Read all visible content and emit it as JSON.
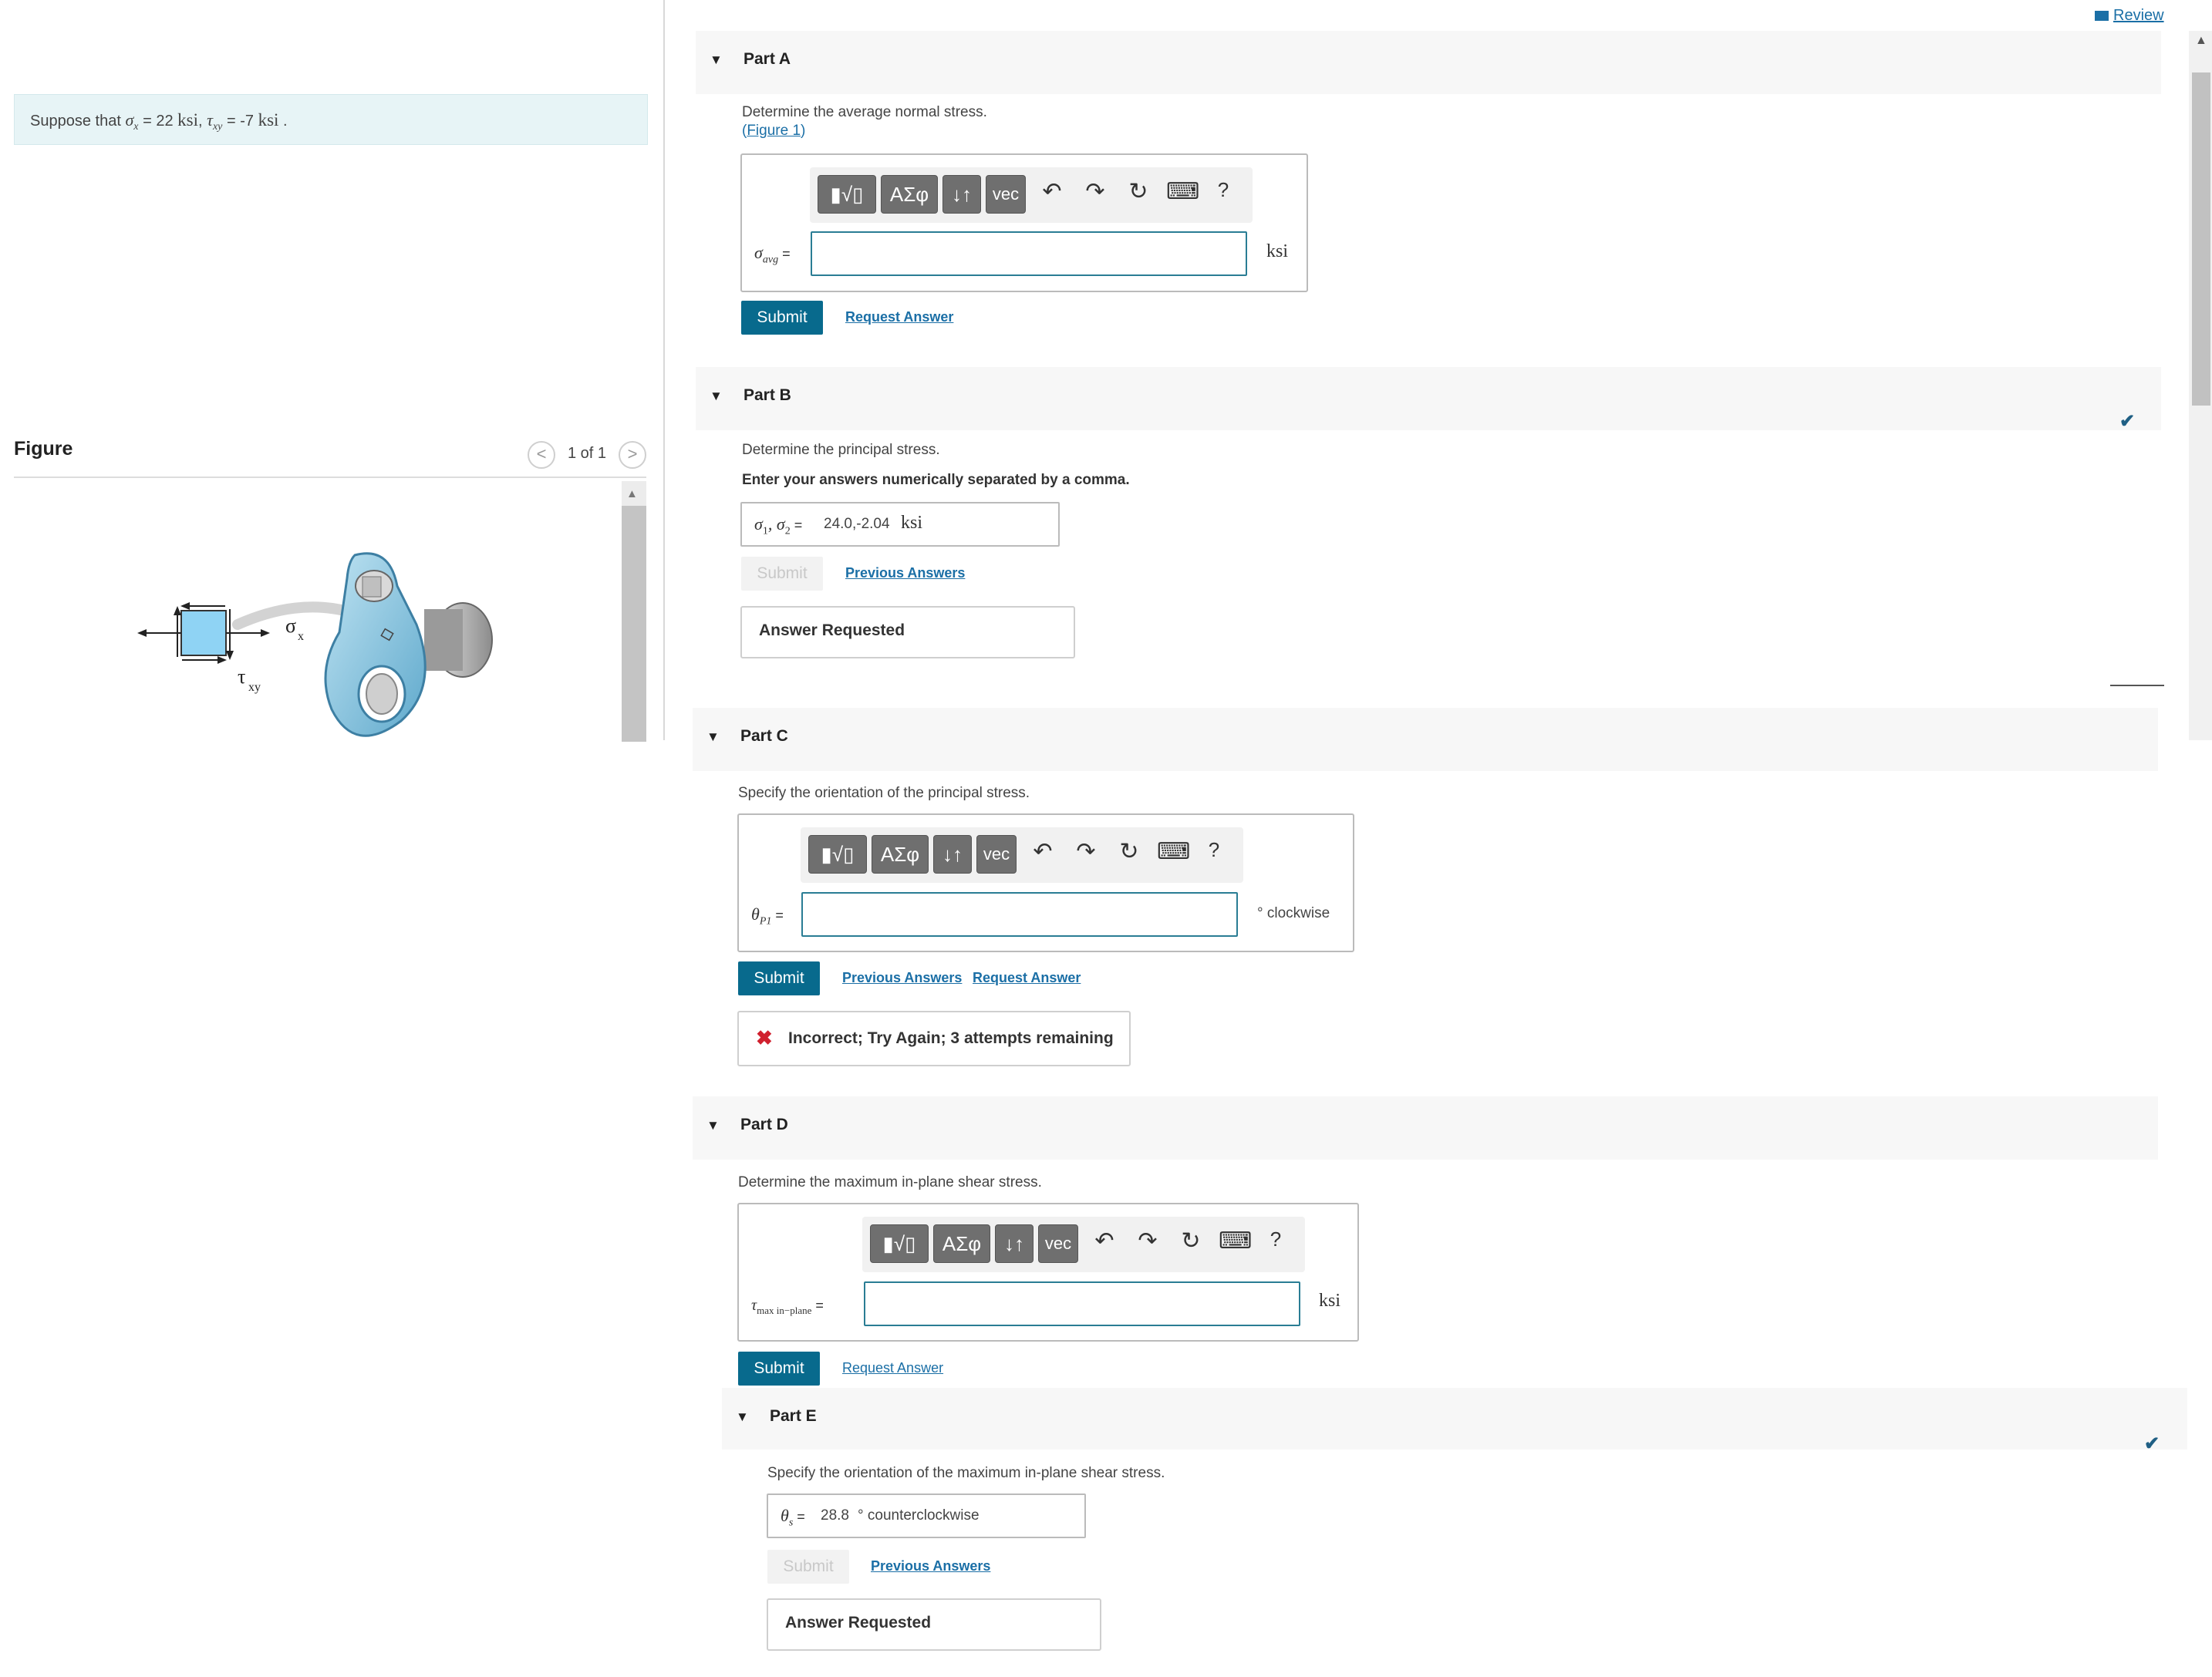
{
  "header": {
    "review_label": "Review"
  },
  "problem": {
    "prefix": "Suppose that",
    "sigma_x_label": "σ",
    "sigma_x_sub": "x",
    "sigma_x_value": "= 22",
    "tau_label": "τ",
    "tau_sub": "xy",
    "tau_value": "= -7",
    "unit": "ksi",
    "sep": ",",
    "end": "."
  },
  "figure": {
    "title": "Figure",
    "pager": "1 of 1",
    "prev_symbol": "<",
    "next_symbol": ">",
    "label_sigma": "σ",
    "label_sigma_sub": "x",
    "label_tau": "τ",
    "label_tau_sub": "xy"
  },
  "toolbar": {
    "templates": "▮√▯",
    "greek": "ΑΣφ",
    "arrows": "↓↑",
    "vec": "vec",
    "undo": "↶",
    "redo": "↷",
    "reset": "↻",
    "keyboard": "⌨",
    "help": "?"
  },
  "partA": {
    "title": "Part A",
    "prompt": "Determine the average normal stress.",
    "figure_link": "Figure 1",
    "paren_open": "(",
    "paren_close": ")",
    "label": "σ",
    "label_sub": "avg",
    "label_eq": " =",
    "unit": "ksi",
    "submit": "Submit",
    "request": "Request Answer"
  },
  "partB": {
    "title": "Part B",
    "prompt": "Determine the principal stress.",
    "note": "Enter your answers numerically separated by a comma.",
    "label": "σ",
    "label_sub1": "1",
    "label_sep": ", σ",
    "label_sub2": "2",
    "label_eq": " =",
    "value": "24.0,-2.04",
    "unit": "ksi",
    "submit": "Submit",
    "previous": "Previous Answers",
    "feedback": "Answer Requested"
  },
  "partC": {
    "title": "Part C",
    "prompt": "Specify the orientation of the principal stress.",
    "label": "θ",
    "label_sub": "P1",
    "label_eq": " =",
    "unit": "° clockwise",
    "submit": "Submit",
    "previous": "Previous Answers",
    "request": "Request Answer",
    "feedback": "Incorrect; Try Again; 3 attempts remaining",
    "x_symbol": "✖"
  },
  "partD": {
    "title": "Part D",
    "prompt": "Determine the maximum in-plane shear stress.",
    "label": "τ",
    "label_sub": "max in−plane",
    "label_eq": " =",
    "unit": "ksi",
    "submit": "Submit",
    "request": "Request Answer"
  },
  "partE": {
    "title": "Part E",
    "prompt": "Specify the orientation of the maximum in-plane shear stress.",
    "label": "θ",
    "label_sub": "s",
    "label_eq": " =",
    "value": "28.8",
    "unit": "° counterclockwise",
    "submit": "Submit",
    "previous": "Previous Answers",
    "feedback": "Answer Requested"
  },
  "marks": {
    "check": "✔"
  }
}
